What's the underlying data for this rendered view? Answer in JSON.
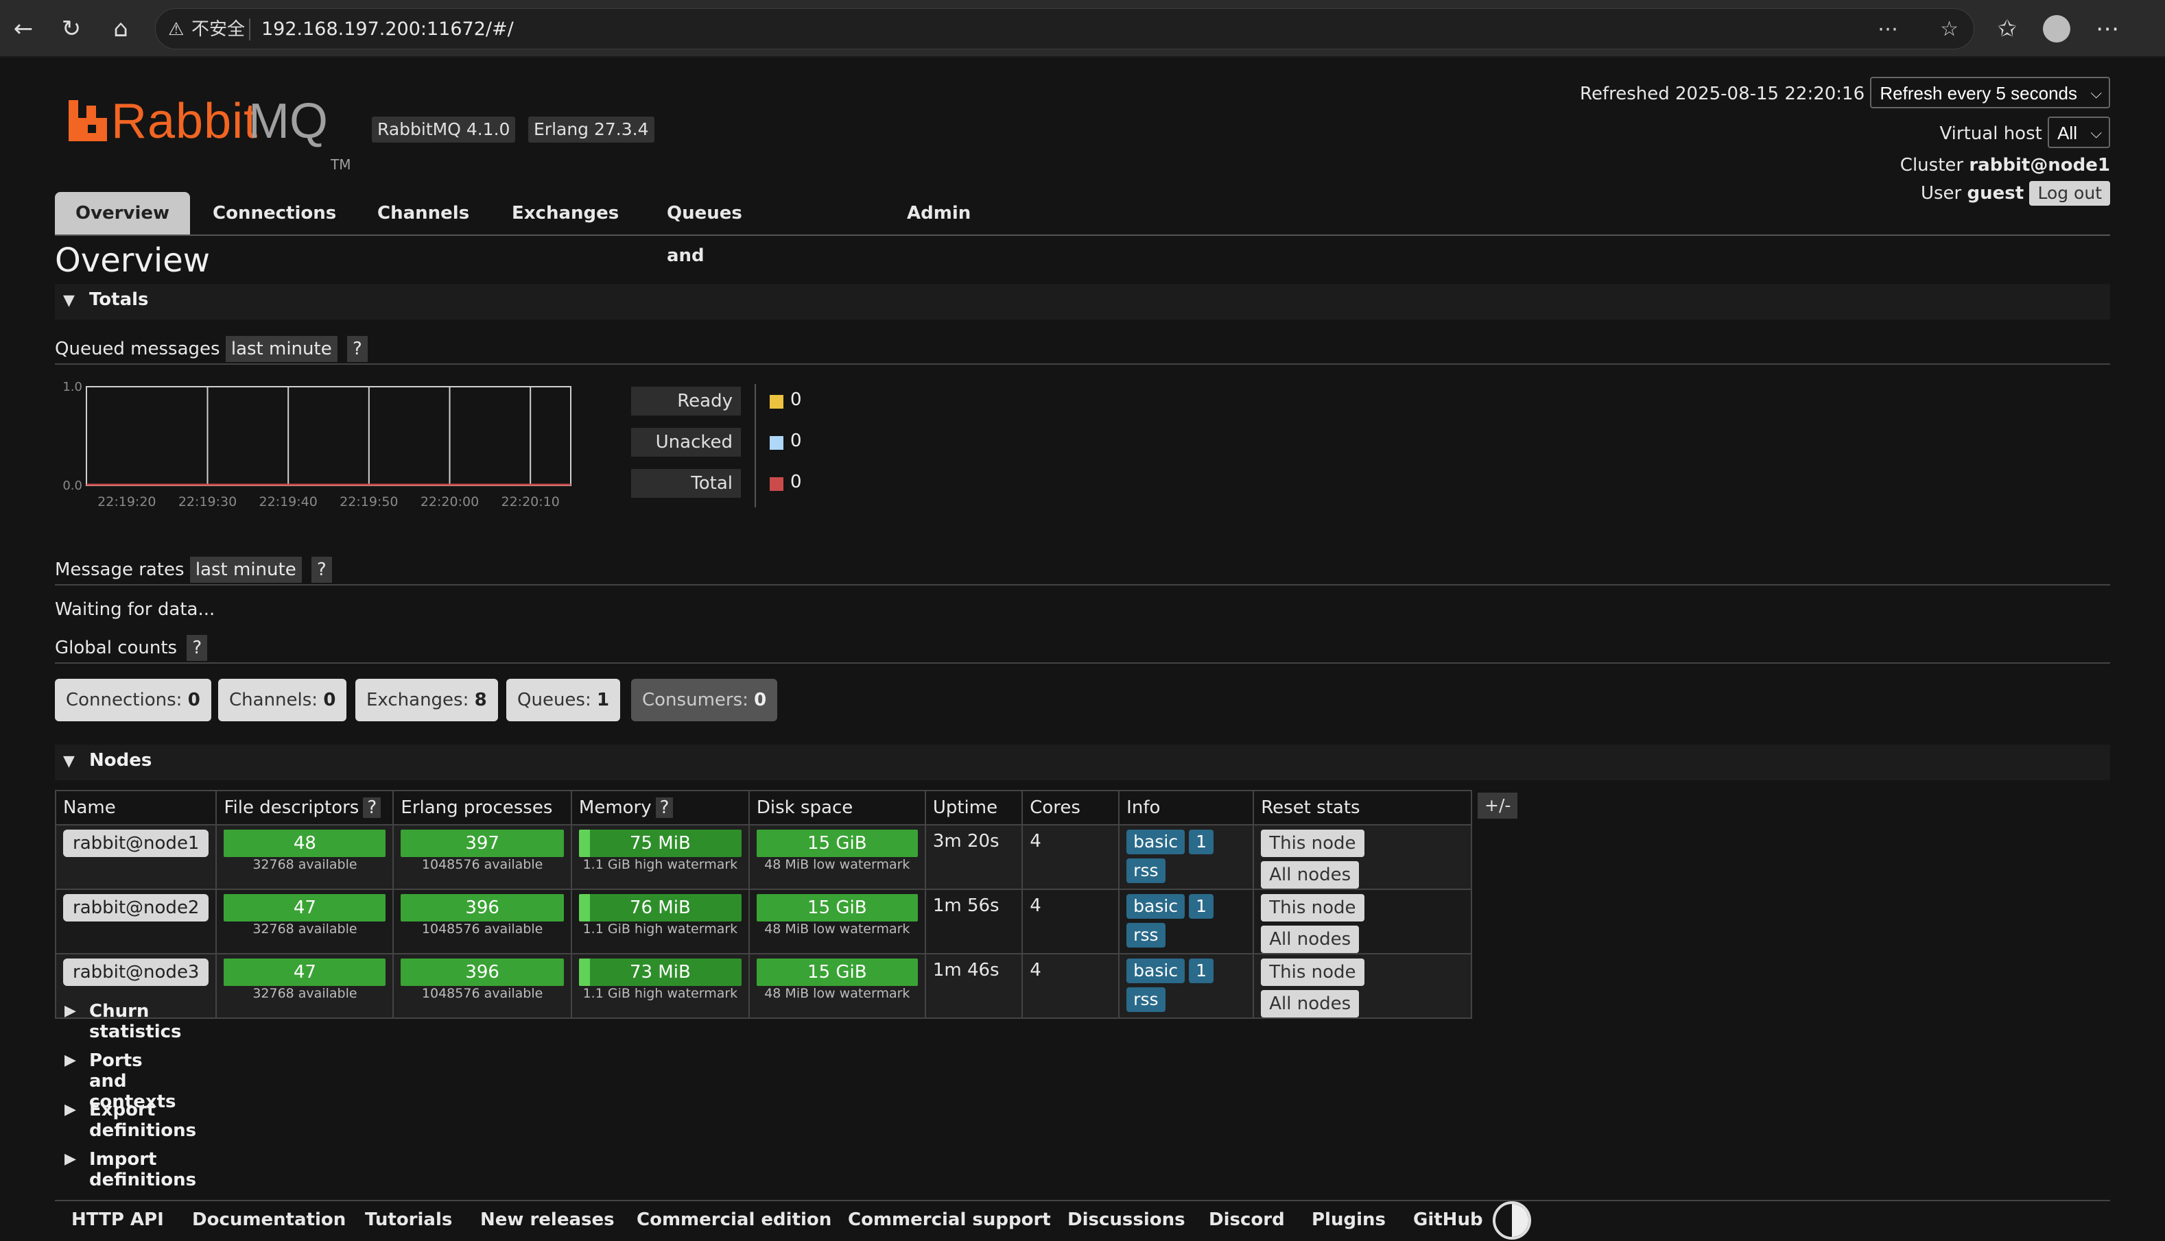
{
  "browser": {
    "insecure_label": "不安全",
    "url": "192.168.197.200:11672/#/"
  },
  "header": {
    "logo_rabbit": "Rabbit",
    "logo_mq": "MQ",
    "logo_tm": "TM",
    "rabbitmq_version": "RabbitMQ 4.1.0",
    "erlang_version": "Erlang 27.3.4",
    "refreshed_label": "Refreshed 2025-08-15 22:20:16",
    "refresh_select": "Refresh every 5 seconds",
    "vhost_label": "Virtual host",
    "vhost_value": "All",
    "cluster_label": "Cluster",
    "cluster_value": "rabbit@node1",
    "user_label": "User",
    "user_value": "guest",
    "logout_label": "Log out"
  },
  "tabs": [
    {
      "label": "Overview"
    },
    {
      "label": "Connections"
    },
    {
      "label": "Channels"
    },
    {
      "label": "Exchanges"
    },
    {
      "label": "Queues and Streams"
    },
    {
      "label": "Admin"
    }
  ],
  "page_title": "Overview",
  "totals": {
    "heading": "Totals",
    "queued_label": "Queued messages",
    "queued_range": "last minute",
    "help": "?",
    "legend": [
      {
        "label": "Ready",
        "value": "0",
        "color": "#edc240"
      },
      {
        "label": "Unacked",
        "value": "0",
        "color": "#afd8f8"
      },
      {
        "label": "Total",
        "value": "0",
        "color": "#cb4b4b"
      }
    ],
    "rates_label": "Message rates",
    "rates_range": "last minute",
    "waiting": "Waiting for data...",
    "global_label": "Global counts"
  },
  "chart_data": {
    "type": "line",
    "x": [
      "22:19:20",
      "22:19:30",
      "22:19:40",
      "22:19:50",
      "22:20:00",
      "22:20:10"
    ],
    "y_ticks": [
      "1.0",
      "0.0"
    ],
    "ylim": [
      0,
      1
    ],
    "series": [
      {
        "name": "Ready",
        "values": [
          0,
          0,
          0,
          0,
          0,
          0
        ]
      },
      {
        "name": "Unacked",
        "values": [
          0,
          0,
          0,
          0,
          0,
          0
        ]
      },
      {
        "name": "Total",
        "values": [
          0,
          0,
          0,
          0,
          0,
          0
        ]
      }
    ]
  },
  "counts": [
    {
      "label": "Connections:",
      "value": "0"
    },
    {
      "label": "Channels:",
      "value": "0"
    },
    {
      "label": "Exchanges:",
      "value": "8"
    },
    {
      "label": "Queues:",
      "value": "1"
    },
    {
      "label": "Consumers:",
      "value": "0"
    }
  ],
  "nodes": {
    "heading": "Nodes",
    "plus_minus": "+/-",
    "columns": [
      "Name",
      "File descriptors",
      "Erlang processes",
      "Memory",
      "Disk space",
      "Uptime",
      "Cores",
      "Info",
      "Reset stats"
    ],
    "rows": [
      {
        "name": "rabbit@node1",
        "fd": "48",
        "fd_sub": "32768 available",
        "proc": "397",
        "proc_sub": "1048576 available",
        "mem": "75 MiB",
        "mem_sub": "1.1 GiB high watermark",
        "mem_fraction": 0.07,
        "disk": "15 GiB",
        "disk_sub": "48 MiB low watermark",
        "uptime": "3m 20s",
        "cores": "4",
        "info": [
          "basic",
          "1",
          "rss"
        ],
        "reset_this": "This node",
        "reset_all": "All nodes"
      },
      {
        "name": "rabbit@node2",
        "fd": "47",
        "fd_sub": "32768 available",
        "proc": "396",
        "proc_sub": "1048576 available",
        "mem": "76 MiB",
        "mem_sub": "1.1 GiB high watermark",
        "mem_fraction": 0.07,
        "disk": "15 GiB",
        "disk_sub": "48 MiB low watermark",
        "uptime": "1m 56s",
        "cores": "4",
        "info": [
          "basic",
          "1",
          "rss"
        ],
        "reset_this": "This node",
        "reset_all": "All nodes"
      },
      {
        "name": "rabbit@node3",
        "fd": "47",
        "fd_sub": "32768 available",
        "proc": "396",
        "proc_sub": "1048576 available",
        "mem": "73 MiB",
        "mem_sub": "1.1 GiB high watermark",
        "mem_fraction": 0.07,
        "disk": "15 GiB",
        "disk_sub": "48 MiB low watermark",
        "uptime": "1m 46s",
        "cores": "4",
        "info": [
          "basic",
          "1",
          "rss"
        ],
        "reset_this": "This node",
        "reset_all": "All nodes"
      }
    ]
  },
  "collapsed_sections": [
    "Churn statistics",
    "Ports and contexts",
    "Export definitions",
    "Import definitions"
  ],
  "footer": [
    "HTTP API",
    "Documentation",
    "Tutorials",
    "New releases",
    "Commercial edition",
    "Commercial support",
    "Discussions",
    "Discord",
    "Plugins",
    "GitHub"
  ]
}
